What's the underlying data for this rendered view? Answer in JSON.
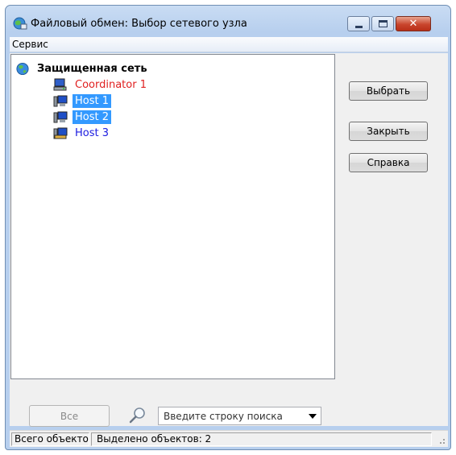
{
  "window": {
    "title": "Файловый обмен: Выбор сетевого узла",
    "icon": "network-globe-icon",
    "controls": {
      "minimize_icon": "minimize-icon",
      "maximize_icon": "maximize-icon",
      "close_glyph": "✕"
    }
  },
  "menu": {
    "items": [
      {
        "label": "Сервис"
      }
    ]
  },
  "tree": {
    "root": {
      "label": "Защищенная сеть",
      "icon": "globe-icon"
    },
    "nodes": [
      {
        "label": "Coordinator 1",
        "icon": "coordinator-icon",
        "color": "#e02020",
        "selected": false
      },
      {
        "label": "Host 1",
        "icon": "host-icon",
        "color": "#1c1ce0",
        "selected": true
      },
      {
        "label": "Host 2",
        "icon": "host-icon",
        "color": "#1c1ce0",
        "selected": true
      },
      {
        "label": "Host 3",
        "icon": "host-icon",
        "color": "#1c1ce0",
        "selected": false
      }
    ]
  },
  "buttons": {
    "select": "Выбрать",
    "close": "Закрыть",
    "help": "Справка",
    "all": "Все"
  },
  "search": {
    "placeholder": "Введите строку поиска",
    "icon": "search-icon"
  },
  "status": {
    "total_objects": "Всего объектов",
    "selected_objects": "Выделено объектов: 2"
  },
  "colors": {
    "selection": "#3399ff",
    "coordinator_text": "#e02020",
    "host_text": "#1c1ce0"
  }
}
